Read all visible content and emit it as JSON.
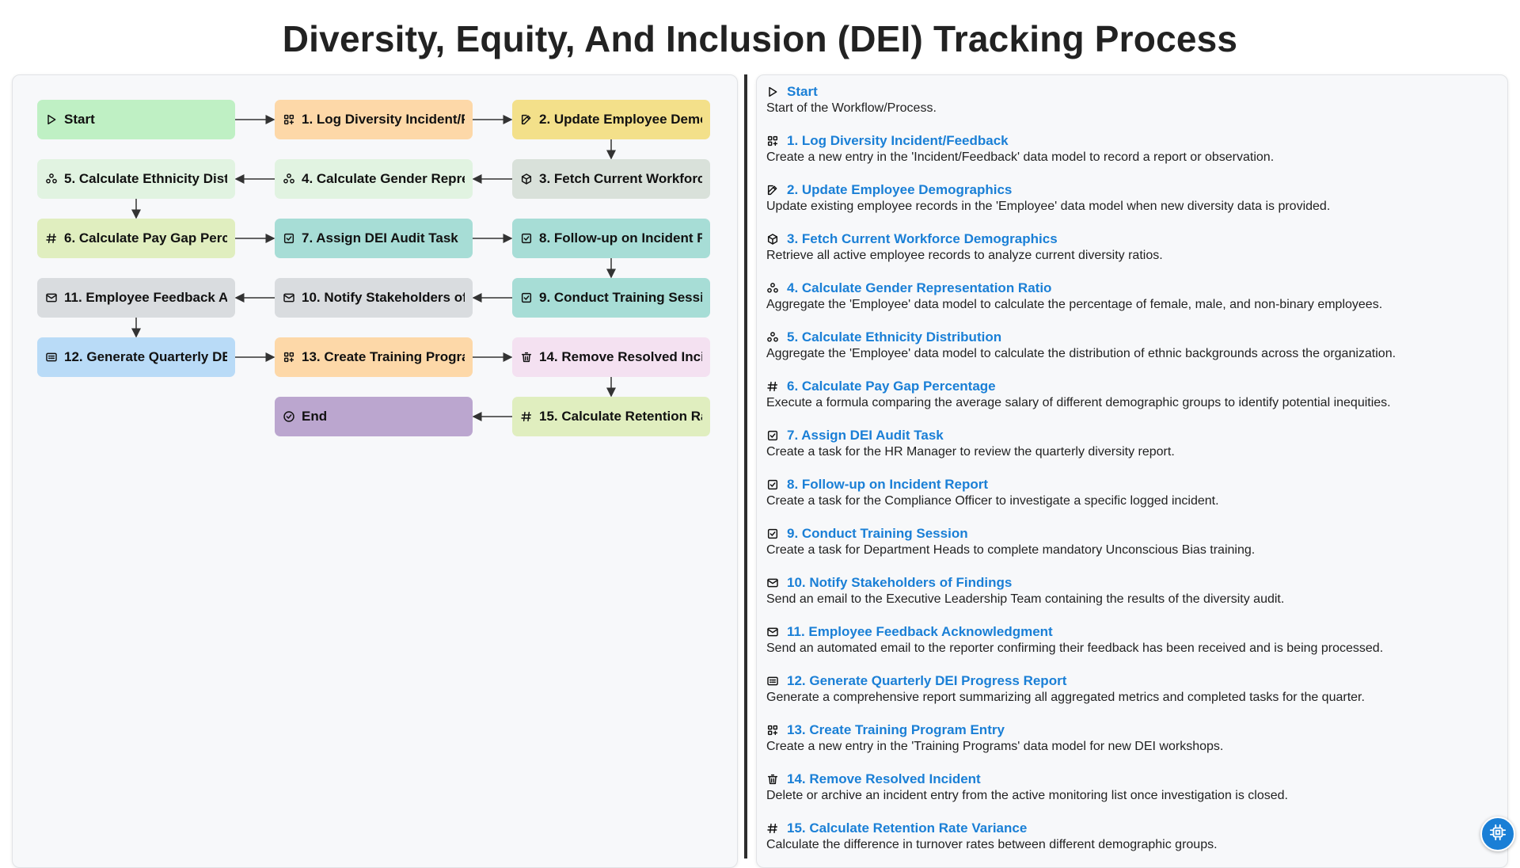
{
  "page": {
    "title": "Diversity, Equity, And Inclusion (DEI) Tracking Process"
  },
  "nodes": [
    {
      "id": "start",
      "label": "Start",
      "icon": "play-icon",
      "color": "#bff0c4"
    },
    {
      "id": "s1",
      "label": "1. Log Diversity Incident/Feedback",
      "icon": "grid-plus-icon",
      "color": "#fdd8a8"
    },
    {
      "id": "s2",
      "label": "2. Update Employee Demographics",
      "icon": "edit-icon",
      "color": "#f3e08a"
    },
    {
      "id": "s3",
      "label": "3. Fetch Current Workforce Demographics",
      "icon": "cube-icon",
      "color": "#d9e1da"
    },
    {
      "id": "s4",
      "label": "4. Calculate Gender Representation Ratio",
      "icon": "cluster-icon",
      "color": "#e1f3e1"
    },
    {
      "id": "s5",
      "label": "5. Calculate Ethnicity Distribution",
      "icon": "cluster-icon",
      "color": "#e1f3e1"
    },
    {
      "id": "s6",
      "label": "6. Calculate Pay Gap Percentage",
      "icon": "hash-icon",
      "color": "#e0eebf"
    },
    {
      "id": "s7",
      "label": "7. Assign DEI Audit Task",
      "icon": "checkbox-icon",
      "color": "#a7ddd6"
    },
    {
      "id": "s8",
      "label": "8. Follow-up on Incident Report",
      "icon": "checkbox-icon",
      "color": "#a7ddd6"
    },
    {
      "id": "s9",
      "label": "9. Conduct Training Session",
      "icon": "checkbox-icon",
      "color": "#a7ddd6"
    },
    {
      "id": "s10",
      "label": "10. Notify Stakeholders of Findings",
      "icon": "mail-icon",
      "color": "#d9dcdf"
    },
    {
      "id": "s11",
      "label": "11. Employee Feedback Acknowledgment",
      "icon": "mail-icon",
      "color": "#d9dcdf"
    },
    {
      "id": "s12",
      "label": "12. Generate Quarterly DEI Progress Report",
      "icon": "report-icon",
      "color": "#b9dbf7"
    },
    {
      "id": "s13",
      "label": "13. Create Training Program Entry",
      "icon": "grid-plus-icon",
      "color": "#fdd8a8"
    },
    {
      "id": "s14",
      "label": "14. Remove Resolved Incident",
      "icon": "trash-icon",
      "color": "#f4e1f1"
    },
    {
      "id": "s15",
      "label": "15. Calculate Retention Rate Variance",
      "icon": "hash-icon",
      "color": "#e0eebf"
    },
    {
      "id": "end",
      "label": "End",
      "icon": "check-circle-icon",
      "color": "#bba6cf"
    }
  ],
  "steps": [
    {
      "title": "Start",
      "desc": "Start of the Workflow/Process.",
      "icon": "play-icon"
    },
    {
      "title": "1. Log Diversity Incident/Feedback",
      "desc": "Create a new entry in the 'Incident/Feedback' data model to record a report or observation.",
      "icon": "grid-plus-icon"
    },
    {
      "title": "2. Update Employee Demographics",
      "desc": "Update existing employee records in the 'Employee' data model when new diversity data is provided.",
      "icon": "edit-icon"
    },
    {
      "title": "3. Fetch Current Workforce Demographics",
      "desc": "Retrieve all active employee records to analyze current diversity ratios.",
      "icon": "cube-icon"
    },
    {
      "title": "4. Calculate Gender Representation Ratio",
      "desc": "Aggregate the 'Employee' data model to calculate the percentage of female, male, and non-binary employees.",
      "icon": "cluster-icon"
    },
    {
      "title": "5. Calculate Ethnicity Distribution",
      "desc": "Aggregate the 'Employee' data model to calculate the distribution of ethnic backgrounds across the organization.",
      "icon": "cluster-icon"
    },
    {
      "title": "6. Calculate Pay Gap Percentage",
      "desc": "Execute a formula comparing the average salary of different demographic groups to identify potential inequities.",
      "icon": "hash-icon"
    },
    {
      "title": "7. Assign DEI Audit Task",
      "desc": "Create a task for the HR Manager to review the quarterly diversity report.",
      "icon": "checkbox-icon"
    },
    {
      "title": "8. Follow-up on Incident Report",
      "desc": "Create a task for the Compliance Officer to investigate a specific logged incident.",
      "icon": "checkbox-icon"
    },
    {
      "title": "9. Conduct Training Session",
      "desc": "Create a task for Department Heads to complete mandatory Unconscious Bias training.",
      "icon": "checkbox-icon"
    },
    {
      "title": "10. Notify Stakeholders of Findings",
      "desc": "Send an email to the Executive Leadership Team containing the results of the diversity audit.",
      "icon": "mail-icon"
    },
    {
      "title": "11. Employee Feedback Acknowledgment",
      "desc": "Send an automated email to the reporter confirming their feedback has been received and is being processed.",
      "icon": "mail-icon"
    },
    {
      "title": "12. Generate Quarterly DEI Progress Report",
      "desc": "Generate a comprehensive report summarizing all aggregated metrics and completed tasks for the quarter.",
      "icon": "report-icon"
    },
    {
      "title": "13. Create Training Program Entry",
      "desc": "Create a new entry in the 'Training Programs' data model for new DEI workshops.",
      "icon": "grid-plus-icon"
    },
    {
      "title": "14. Remove Resolved Incident",
      "desc": "Delete or archive an incident entry from the active monitoring list once investigation is closed.",
      "icon": "trash-icon"
    },
    {
      "title": "15. Calculate Retention Rate Variance",
      "desc": "Calculate the difference in turnover rates between different demographic groups.",
      "icon": "hash-icon"
    },
    {
      "title": "End",
      "desc": "",
      "icon": "check-circle-icon"
    }
  ],
  "fab": {
    "icon": "chip-icon"
  }
}
